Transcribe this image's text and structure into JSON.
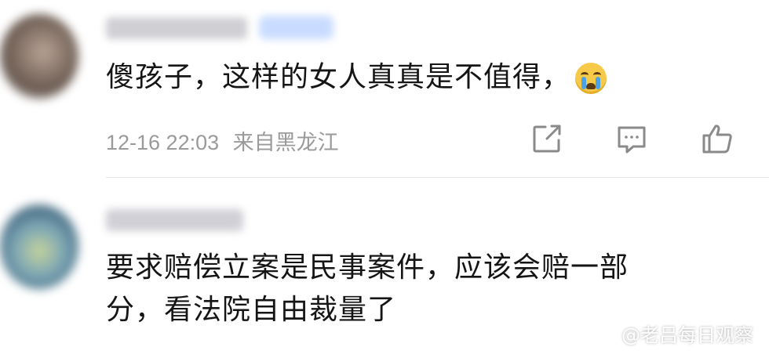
{
  "comments": [
    {
      "text": "傻孩子，这样的女人真真是不值得，",
      "emoji": "crying-face",
      "timestamp": "12-16 22:03",
      "location": "来自黑龙江"
    },
    {
      "line1": "要求赔偿立案是民事案件，应该会赔一部",
      "line2": "分，看法院自由裁量了"
    }
  ],
  "actions": [
    "share-icon",
    "comment-icon",
    "like-icon"
  ],
  "watermark": "@老吕每日观察",
  "colors": {
    "meta_text": "#9a9a9a",
    "body_text": "#151515",
    "divider": "#e6e6e6"
  }
}
